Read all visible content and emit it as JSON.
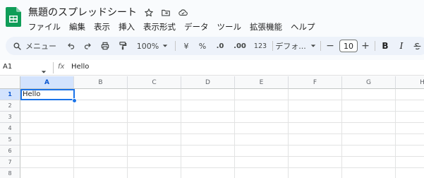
{
  "document": {
    "title": "無題のスプレッドシート"
  },
  "menu": [
    "ファイル",
    "編集",
    "表示",
    "挿入",
    "表示形式",
    "データ",
    "ツール",
    "拡張機能",
    "ヘルプ"
  ],
  "toolbar": {
    "search_label": "メニュー",
    "zoom": "100%",
    "currency": "¥",
    "percent": "%",
    "decrease_decimal": ".0",
    "increase_decimal": ".00",
    "number_format": "123",
    "font_name": "デフォ...",
    "font_size": "10",
    "minus": "−",
    "plus": "+",
    "bold": "B",
    "italic": "I"
  },
  "formula_bar": {
    "name_box": "A1",
    "fx_label": "fx",
    "content": "Hello"
  },
  "grid": {
    "columns": [
      "A",
      "B",
      "C",
      "D",
      "E",
      "F",
      "G",
      "H"
    ],
    "rows": [
      "1",
      "2",
      "3",
      "4",
      "5",
      "6",
      "7",
      "8"
    ],
    "cells": {
      "A1": "Hello"
    },
    "selected_cell": "A1"
  },
  "colors": {
    "selection": "#1a73e8",
    "app_green": "#0f9d58"
  }
}
